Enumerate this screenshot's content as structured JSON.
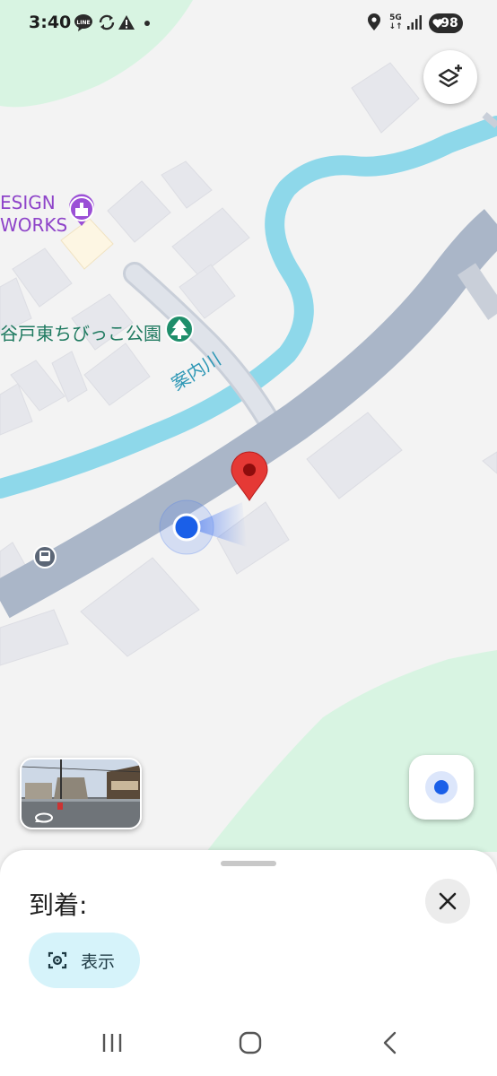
{
  "status_bar": {
    "time": "3:40",
    "network": "5G",
    "battery": "98",
    "icons": [
      "line-app-icon",
      "sync-icon",
      "alert-icon",
      "dot-icon",
      "location-icon",
      "5g-icon",
      "signal-icon",
      "battery-icon"
    ]
  },
  "map": {
    "poi_design_name": [
      "ESIGN",
      "WORKS"
    ],
    "poi_design_icon": "shop-icon",
    "poi_park_name": "谷戸東ちびっこ公園",
    "poi_park_icon": "tree-icon",
    "river_name": "案内川",
    "bus_stop_icon": "bus-icon",
    "destination_pin_icon": "map-pin-icon",
    "colors": {
      "background": "#f3f3f3",
      "park": "#d8f4e2",
      "river": "#8ed8ea",
      "road": "#aab6c8",
      "building": "#e6e7ec",
      "pin": "#e53935",
      "location_dot": "#1a5fe8"
    }
  },
  "controls": {
    "layers_icon": "layers-plus-icon",
    "my_location_icon": "my-location-icon",
    "streetview_icon": "360-rotate-icon"
  },
  "sheet": {
    "arrival_title": "到着:",
    "close_icon": "close-icon",
    "show_button_label": "表示",
    "show_button_icon": "camera-scan-icon"
  },
  "nav_bar": {
    "recent_icon": "recent-apps-icon",
    "home_icon": "home-icon",
    "back_icon": "back-icon"
  }
}
